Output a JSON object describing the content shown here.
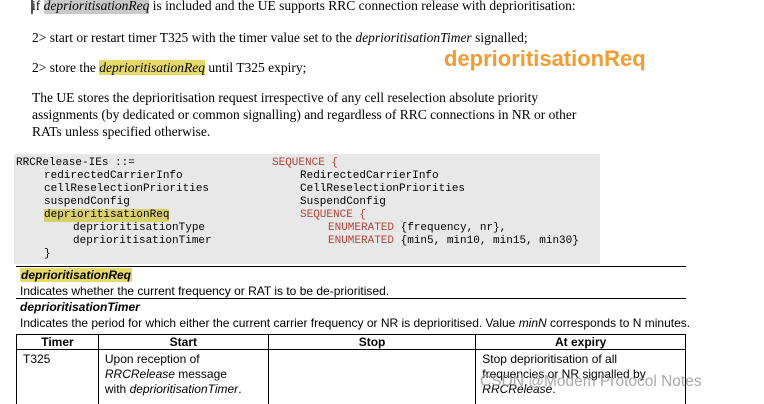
{
  "spec_text": {
    "line1": {
      "prefix": "if ",
      "field": "deprioritisationReq",
      "suffix": " is included and the UE supports RRC connection release with deprioritisation:"
    },
    "line2": {
      "prefix": "2> start or restart timer T325 with the timer value set to the ",
      "field": "deprioritisationTimer",
      "suffix": " signalled;"
    },
    "line3": {
      "prefix": "2> store the ",
      "field": "deprioritisationReq",
      "suffix": " until T325 expiry;"
    },
    "para": [
      "The UE stores the deprioritisation request irrespective of any cell reselection absolute priority",
      "assignments (by dedicated or common signalling) and regardless of RRC connections in NR or other",
      "RATs unless specified otherwise."
    ]
  },
  "callout": "deprioritisationReq",
  "asn1": {
    "header_left": "RRCRelease-IEs ::=",
    "header_right": "SEQUENCE {",
    "rows": [
      {
        "name": "redirectedCarrierInfo",
        "type": "RedirectedCarrierInfo"
      },
      {
        "name": "cellReselectionPriorities",
        "type": "CellReselectionPriorities"
      },
      {
        "name": "suspendConfig",
        "type": "SuspendConfig"
      },
      {
        "name": "deprioritisationReq",
        "type": "SEQUENCE {"
      },
      {
        "name": "deprioritisationType",
        "kw": "ENUMERATED",
        "type": "{frequency, nr},"
      },
      {
        "name": "deprioritisationTimer",
        "kw": "ENUMERATED",
        "type": "{min5, min10, min15, min30}"
      }
    ],
    "close": "}"
  },
  "fields": [
    {
      "name": "deprioritisationReq",
      "desc": "Indicates whether the current frequency or RAT is to be de-prioritised."
    },
    {
      "name": "deprioritisationTimer",
      "desc_prefix": "Indicates the period for which either the current carrier frequency or NR is deprioritised. Value ",
      "desc_var": "minN",
      "desc_suffix": " corresponds to N minutes."
    }
  ],
  "timer_table": {
    "headers": [
      "Timer",
      "Start",
      "Stop",
      "At expiry"
    ],
    "row": {
      "timer": "T325",
      "start_1": "Upon reception of",
      "start_2": "RRCRelease",
      "start_3": " message",
      "start_4": "with ",
      "start_5": "deprioritisationTimer",
      "start_6": ".",
      "stop": "",
      "expiry_1": "Stop deprioritisation of all",
      "expiry_2": "frequencies or NR signalled by",
      "expiry_3": "RRCRelease",
      "expiry_4": "."
    }
  },
  "watermark": "CSDN @Modem Protocol Notes",
  "colors": {
    "highlight": "#e5d96a",
    "callout": "#f39c32",
    "asn_keyword": "#b5443a",
    "code_bg": "#e8e8e8"
  }
}
